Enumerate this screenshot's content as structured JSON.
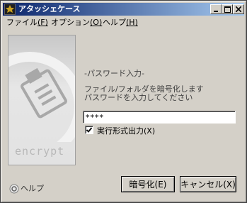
{
  "window": {
    "title": "アタッシェケース"
  },
  "menu": [
    {
      "label": "ファイル",
      "accel": "(F)"
    },
    {
      "label": "オプション",
      "accel": "(O)"
    },
    {
      "label": "ヘルプ",
      "accel": "(H)"
    }
  ],
  "sidebar": {
    "brand_word": "encrypt"
  },
  "content": {
    "heading": "-パスワード入力-",
    "description_1": "ファイル/フォルダを暗号化します",
    "description_2": "パスワードを入力してください",
    "password_value": "****",
    "checkbox_label": "実行形式出力(X)",
    "checkbox_checked": true
  },
  "footer": {
    "help_label": "ヘルプ",
    "encrypt_button": "暗号化(E)",
    "cancel_button": "キャンセル(X)"
  },
  "icons": {
    "app": "briefcase-icon",
    "help": "help-circle-icon",
    "check": "checkmark-icon"
  }
}
